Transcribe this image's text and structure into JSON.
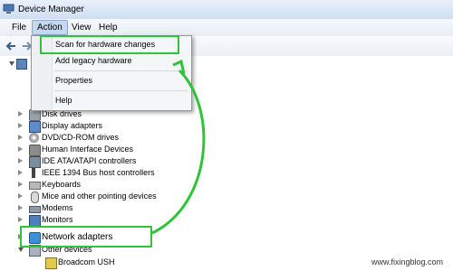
{
  "window": {
    "title": "Device Manager"
  },
  "menubar": {
    "items": [
      "File",
      "Action",
      "View",
      "Help"
    ]
  },
  "action_menu": {
    "items": [
      "Scan for hardware changes",
      "Add legacy hardware",
      "Properties",
      "Help"
    ]
  },
  "tree": {
    "items": [
      {
        "label": "Disk drives",
        "icon": "disk-icon"
      },
      {
        "label": "Display adapters",
        "icon": "display-icon"
      },
      {
        "label": "DVD/CD-ROM drives",
        "icon": "dvd-icon"
      },
      {
        "label": "Human Interface Devices",
        "icon": "hid-icon"
      },
      {
        "label": "IDE ATA/ATAPI controllers",
        "icon": "ide-icon"
      },
      {
        "label": "IEEE 1394 Bus host controllers",
        "icon": "firewire-icon"
      },
      {
        "label": "Keyboards",
        "icon": "keyboard-icon"
      },
      {
        "label": "Mice and other pointing devices",
        "icon": "mouse-icon"
      },
      {
        "label": "Modems",
        "icon": "modem-icon"
      },
      {
        "label": "Monitors",
        "icon": "monitor-icon"
      },
      {
        "label": "Network adapters",
        "icon": "network-icon"
      },
      {
        "label": "Other devices",
        "icon": "other-devices-icon"
      },
      {
        "label": "Broadcom USH",
        "icon": "warning-device-icon"
      }
    ]
  },
  "watermark": "www.fixingblog.com",
  "colors": {
    "highlight": "#2fc33a",
    "menu_active": "#c6d8ee"
  }
}
